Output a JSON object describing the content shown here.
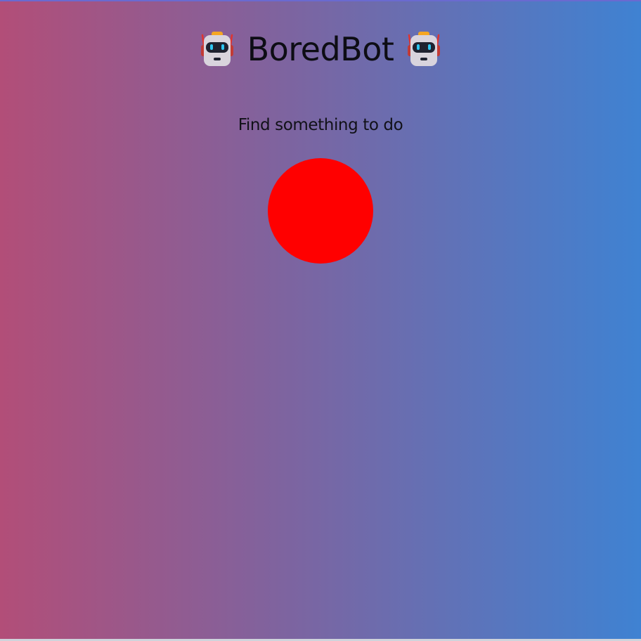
{
  "app": {
    "title": "BoredBot",
    "subtitle": "Find something to do"
  },
  "icons": {
    "left": "robot-icon",
    "right": "robot-icon"
  },
  "action_button": {
    "color": "#ff0000",
    "shape": "circle"
  },
  "colors": {
    "gradient_left": "#b24e78",
    "gradient_right": "#3f82d2",
    "accent": "#ff0000"
  }
}
